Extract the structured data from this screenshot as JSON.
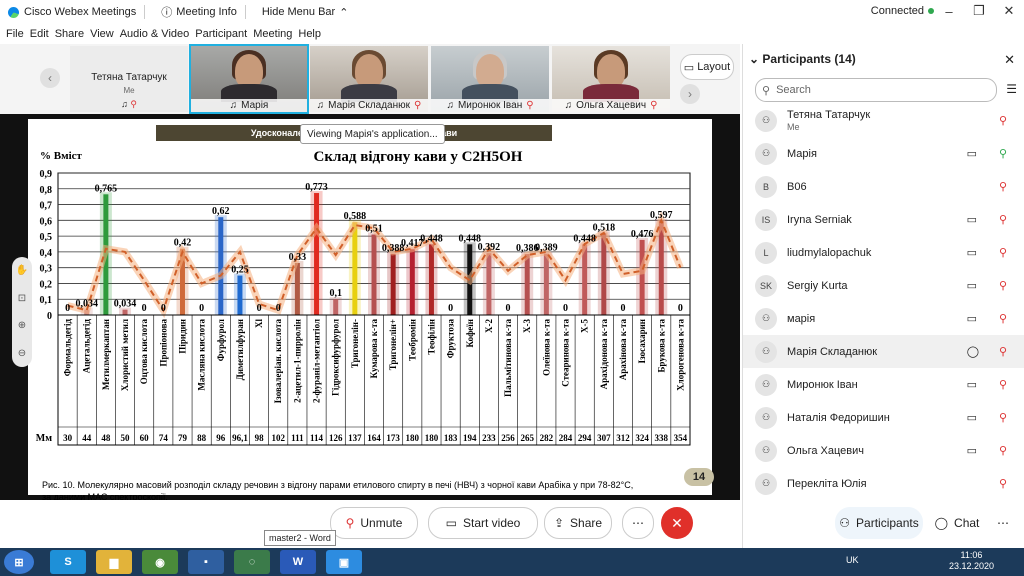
{
  "titlebar": {
    "app": "Cisco Webex Meetings",
    "meeting_info": "Meeting Info",
    "hide_menu": "Hide Menu Bar",
    "status": "Connected"
  },
  "menu": [
    "File",
    "Edit",
    "Share",
    "View",
    "Audio & Video",
    "Participant",
    "Meeting",
    "Help"
  ],
  "video": {
    "self": {
      "name": "Тетяна Татарчук",
      "sub": "Me"
    },
    "tiles": [
      "Марія",
      "Марія Складанюк",
      "Миронюк Іван",
      "Ольга Хацевич"
    ],
    "layout_label": "Layout"
  },
  "share": {
    "viewing": "Viewing Марія's application...",
    "slide_header": "Удосконалення технології ... натуральної кави",
    "page": "14",
    "caption_line1": "Рис. 10. Молекулярно масовий розподіл складу речовин   з відгону парами етилового спирту в печі (НВЧ) з чорної кави  Арабіка у при 78-82°С,",
    "caption_line2": "за даними МАС спектроскопії."
  },
  "chart_data": {
    "type": "bar",
    "title": "Склад відгону кави у C2H5OH",
    "ylabel": "% Вміст",
    "ylim": [
      0,
      0.9
    ],
    "yticks": [
      "0",
      "0,1",
      "0,2",
      "0,3",
      "0,4",
      "0,5",
      "0,6",
      "0,7",
      "0,8",
      "0,9"
    ],
    "row_label": "Мм",
    "categories": [
      "Формальдегід",
      "Ацетальдегід",
      "Метилмеркаптан",
      "Хлористий метил",
      "Оцтова кислота",
      "Пропіонова",
      "Піридин",
      "Масляна кислота",
      "Фурфурол",
      "Диметилфуран",
      "Хl",
      "Ізовалеріан. кислота",
      "2-ацетил-1-пирролін",
      "2-фураніл-метантіол",
      "Гідроксифурфурол",
      "Тригонелін-",
      "Кумарова к-та",
      "Тригонелін+",
      "Теобромін",
      "Теофілін",
      "Фруктоза",
      "Кофеїн",
      "Х-2",
      "Пальмітинова к-та",
      "Х-3",
      "Олеїнова к-та",
      "Стеаринова к-та",
      "Х-5",
      "Арахідонова к-та",
      "Арахінова к-та",
      "Ізосахарин",
      "Брукова к-та",
      "Хлорогенова к-та"
    ],
    "mm": [
      "30",
      "44",
      "48",
      "50",
      "60",
      "74",
      "79",
      "88",
      "96",
      "96,1",
      "98",
      "102",
      "111",
      "114",
      "126",
      "137",
      "164",
      "173",
      "180",
      "180",
      "183",
      "194",
      "233",
      "256",
      "265",
      "282",
      "284",
      "294",
      "307",
      "312",
      "324",
      "338",
      "354"
    ],
    "values": [
      0,
      0.034,
      0.765,
      0.034,
      0,
      0,
      0.42,
      0,
      0.62,
      0.25,
      0,
      0,
      0.33,
      0.773,
      0.1,
      0.588,
      0.51,
      0.388,
      0.417,
      0.448,
      0,
      0.448,
      0.392,
      0,
      0.386,
      0.389,
      0,
      0.448,
      0.518,
      0,
      0.476,
      0.597,
      0
    ],
    "labels": [
      "0",
      "0,034",
      "0,765",
      "0,034",
      "0",
      "0",
      "0,42",
      "0",
      "0,62",
      "0,25",
      "0",
      "0",
      "0,33",
      "0,773",
      "0,1",
      "0,588",
      "0,51",
      "0,388",
      "0,417",
      "0,448",
      "0",
      "0,448",
      "0,392",
      "0",
      "0,386",
      "0,389",
      "0",
      "0,448",
      "0,518",
      "0",
      "0,476",
      "0,597",
      "0"
    ],
    "colors": [
      "#c88",
      "#c88",
      "#2e9a3c",
      "#c06565",
      "#c88",
      "#c88",
      "#cf6a3a",
      "#c88",
      "#2a66c8",
      "#1e6ad0",
      "#c88",
      "#c88",
      "#b05a44",
      "#e02a20",
      "#c06565",
      "#e8d010",
      "#b55050",
      "#a02020",
      "#b52030",
      "#b02828",
      "#c88",
      "#111111",
      "#c06565",
      "#c88",
      "#b65050",
      "#c06565",
      "#c88",
      "#c05a5a",
      "#b04848",
      "#c88",
      "#c05050",
      "#b84a4a",
      "#c88"
    ],
    "trend": [
      0.06,
      0.03,
      0.42,
      0.4,
      0.22,
      0.03,
      0.4,
      0.2,
      0.25,
      0.4,
      0.07,
      0.03,
      0.38,
      0.55,
      0.38,
      0.57,
      0.55,
      0.4,
      0.42,
      0.48,
      0.3,
      0.22,
      0.42,
      0.28,
      0.38,
      0.4,
      0.22,
      0.45,
      0.52,
      0.26,
      0.28,
      0.6,
      0.3
    ]
  },
  "controls": {
    "mute": "Unmute",
    "video": "Start video",
    "share": "Share",
    "participants": "Participants",
    "chat": "Chat"
  },
  "taskbar_tooltip": "master2 - Word",
  "participants": {
    "title": "Participants (14)",
    "search_placeholder": "Search",
    "list": [
      {
        "initials": "",
        "name": "Тетяна Татарчук",
        "sub": "Me"
      },
      {
        "initials": "",
        "name": "Марія",
        "sub": ""
      },
      {
        "initials": "B",
        "name": "B06",
        "sub": ""
      },
      {
        "initials": "IS",
        "name": "Iryna Serniak",
        "sub": ""
      },
      {
        "initials": "L",
        "name": "liudmylalopachuk",
        "sub": ""
      },
      {
        "initials": "SK",
        "name": "Sergiy Kurta",
        "sub": ""
      },
      {
        "initials": "",
        "name": "марія",
        "sub": ""
      },
      {
        "initials": "",
        "name": "Марія Складанюк",
        "sub": ""
      },
      {
        "initials": "",
        "name": "Миронюк Іван",
        "sub": ""
      },
      {
        "initials": "",
        "name": "Наталія Федоришин",
        "sub": ""
      },
      {
        "initials": "",
        "name": "Ольга Хацевич",
        "sub": ""
      },
      {
        "initials": "",
        "name": "Перекліта Юлія",
        "sub": ""
      }
    ]
  },
  "tray": {
    "lang": "UK",
    "time": "11:06",
    "date": "23.12.2020"
  }
}
